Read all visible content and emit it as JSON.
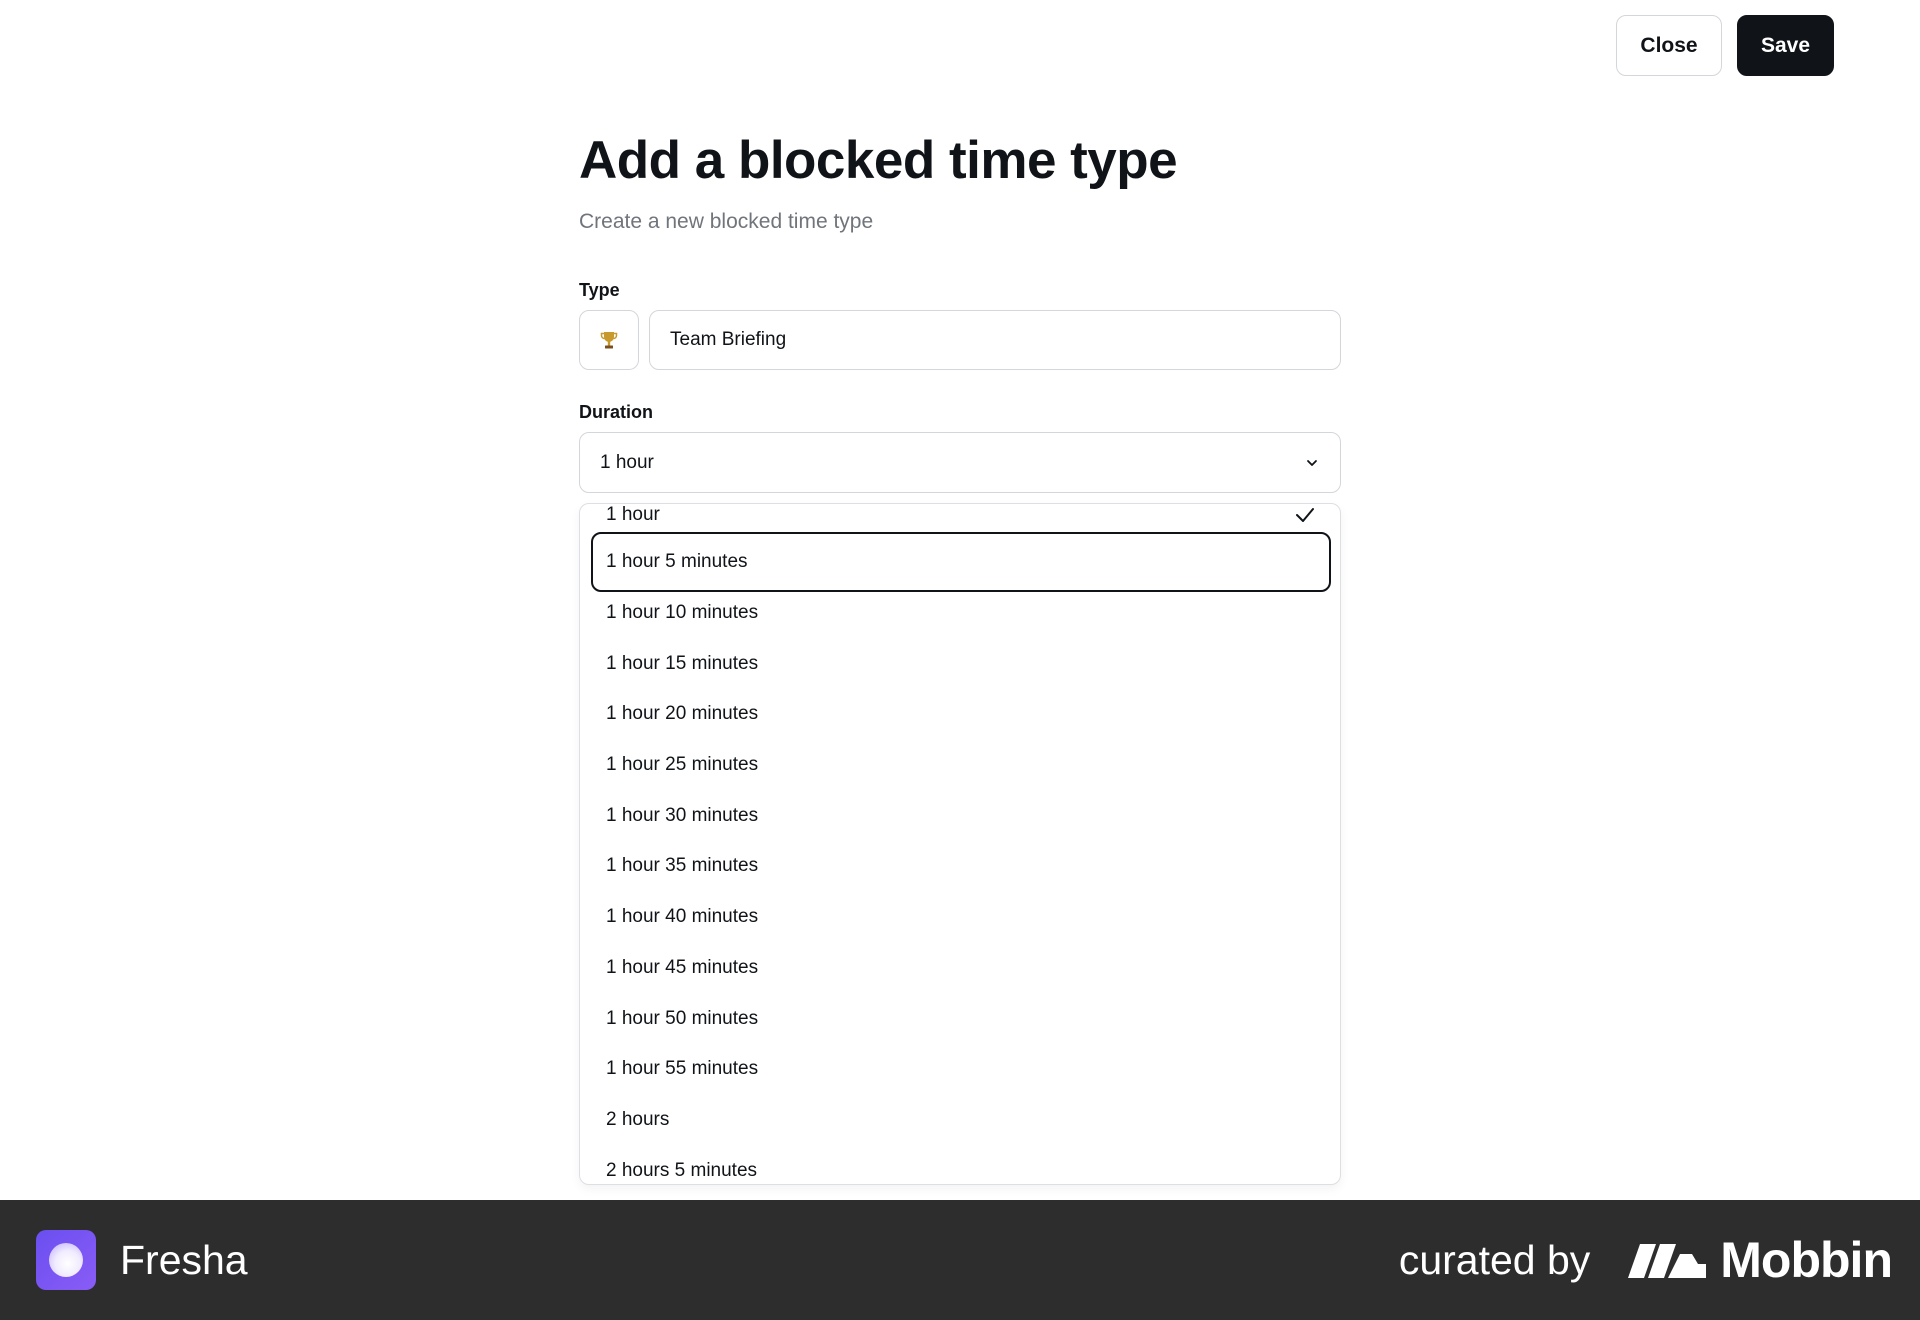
{
  "header": {
    "close_label": "Close",
    "save_label": "Save"
  },
  "form": {
    "title": "Add a blocked time type",
    "subtitle": "Create a new blocked time type",
    "type": {
      "label": "Type",
      "icon": "trophy-icon",
      "value": "Team Briefing"
    },
    "duration": {
      "label": "Duration",
      "value": "1 hour",
      "options": [
        "1 hour",
        "1 hour 5 minutes",
        "1 hour 10 minutes",
        "1 hour 15 minutes",
        "1 hour 20 minutes",
        "1 hour 25 minutes",
        "1 hour 30 minutes",
        "1 hour 35 minutes",
        "1 hour 40 minutes",
        "1 hour 45 minutes",
        "1 hour 50 minutes",
        "1 hour 55 minutes",
        "2 hours",
        "2 hours 5 minutes"
      ],
      "selected_option": "1 hour",
      "highlighted_option": "1 hour 5 minutes"
    }
  },
  "footer": {
    "app_name": "Fresha",
    "curated_by": "curated by",
    "brand": "Mobbin"
  }
}
